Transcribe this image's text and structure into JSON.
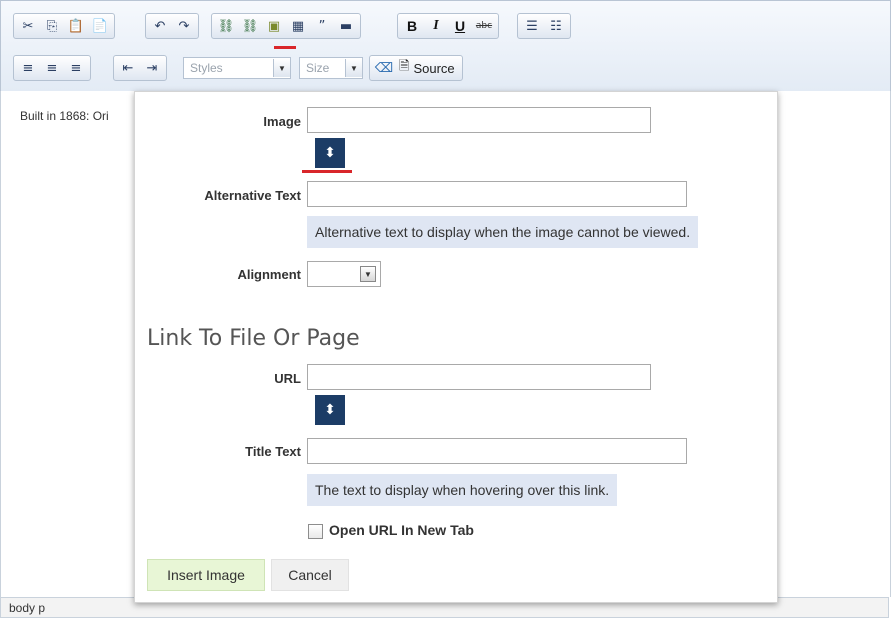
{
  "toolbar": {
    "styles_placeholder": "Styles",
    "size_placeholder": "Size",
    "source_label": "Source",
    "bold_label": "B",
    "italic_label": "I",
    "underline_label": "U",
    "strike_label": "abc",
    "quote_label": "”"
  },
  "editor": {
    "content_text": "Built in 1868: Ori",
    "status_path": "body  p"
  },
  "dialog": {
    "image_label": "Image",
    "image_value": "",
    "alt_label": "Alternative Text",
    "alt_value": "",
    "alt_hint": "Alternative text to display when the image cannot be viewed.",
    "alignment_label": "Alignment",
    "alignment_value": "",
    "link_heading": "Link To File Or Page",
    "url_label": "URL",
    "url_value": "",
    "title_label": "Title Text",
    "title_value": "",
    "title_hint": "The text to display when hovering over this link.",
    "new_tab_label": "Open URL In New Tab",
    "new_tab_checked": false,
    "insert_label": "Insert Image",
    "cancel_label": "Cancel"
  },
  "colors": {
    "picker_bg": "#1c3c66",
    "marker": "#d9262a",
    "hint_bg": "#dfe6f3",
    "insert_bg": "#e8f6d6"
  }
}
